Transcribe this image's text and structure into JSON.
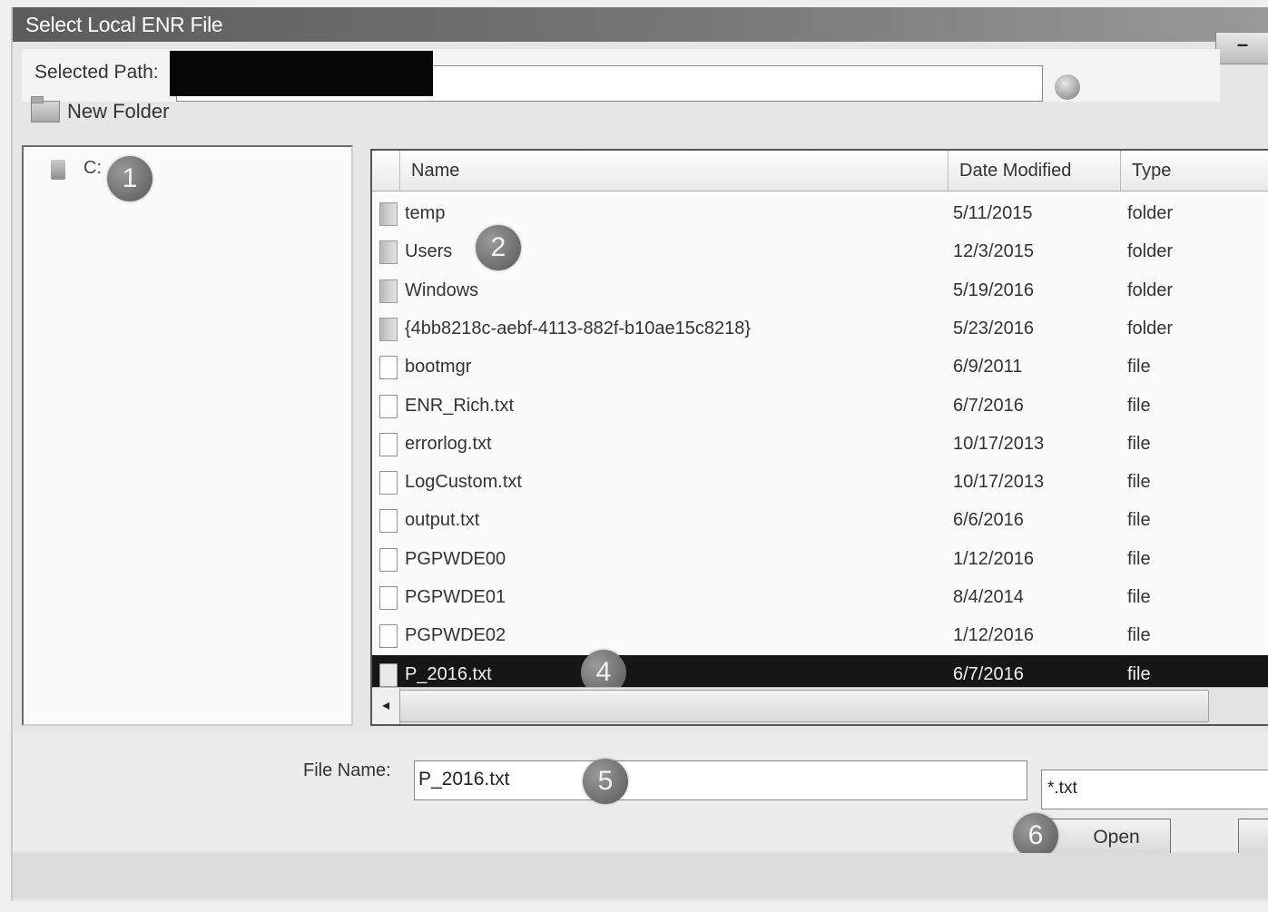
{
  "window": {
    "title": "Select Local ENR File",
    "minimize": "–"
  },
  "path": {
    "label": "Selected Path:",
    "value": ""
  },
  "toolbar": {
    "new_folder": "New Folder"
  },
  "tree": {
    "drive": "C:"
  },
  "badges": [
    "1",
    "2",
    "4",
    "5",
    "6"
  ],
  "list": {
    "columns": [
      "Name",
      "Date Modified",
      "Type"
    ],
    "rows": [
      {
        "name": "temp",
        "date": "5/11/2015",
        "type": "folder",
        "icon": "folder-icon"
      },
      {
        "name": "Users",
        "date": "12/3/2015",
        "type": "folder",
        "icon": "folder-icon"
      },
      {
        "name": "Windows",
        "date": "5/19/2016",
        "type": "folder",
        "icon": "folder-icon"
      },
      {
        "name": "{4bb8218c-aebf-4113-882f-b10ae15c8218}",
        "date": "5/23/2016",
        "type": "folder",
        "icon": "folder-icon"
      },
      {
        "name": "bootmgr",
        "date": "6/9/2011",
        "type": "file",
        "icon": "file-icon"
      },
      {
        "name": "ENR_Rich.txt",
        "date": "6/7/2016",
        "type": "file",
        "icon": "file-icon"
      },
      {
        "name": "errorlog.txt",
        "date": "10/17/2013",
        "type": "file",
        "icon": "file-icon"
      },
      {
        "name": "LogCustom.txt",
        "date": "10/17/2013",
        "type": "file",
        "icon": "file-icon"
      },
      {
        "name": "output.txt",
        "date": "6/6/2016",
        "type": "file",
        "icon": "file-icon"
      },
      {
        "name": "PGPWDE00",
        "date": "1/12/2016",
        "type": "file",
        "icon": "file-icon"
      },
      {
        "name": "PGPWDE01",
        "date": "8/4/2014",
        "type": "file",
        "icon": "file-icon"
      },
      {
        "name": "PGPWDE02",
        "date": "1/12/2016",
        "type": "file",
        "icon": "file-icon"
      },
      {
        "name": "P_2016.txt",
        "date": "6/7/2016",
        "type": "file",
        "icon": "file-icon",
        "selected": true
      }
    ],
    "scroll_left": "◂"
  },
  "file": {
    "label": "File Name:",
    "value": "P_2016.txt",
    "filter": "*.txt"
  },
  "buttons": {
    "open": "Open"
  },
  "colors": {
    "selected_row": "#161616",
    "badge": "#6b6b6b"
  }
}
